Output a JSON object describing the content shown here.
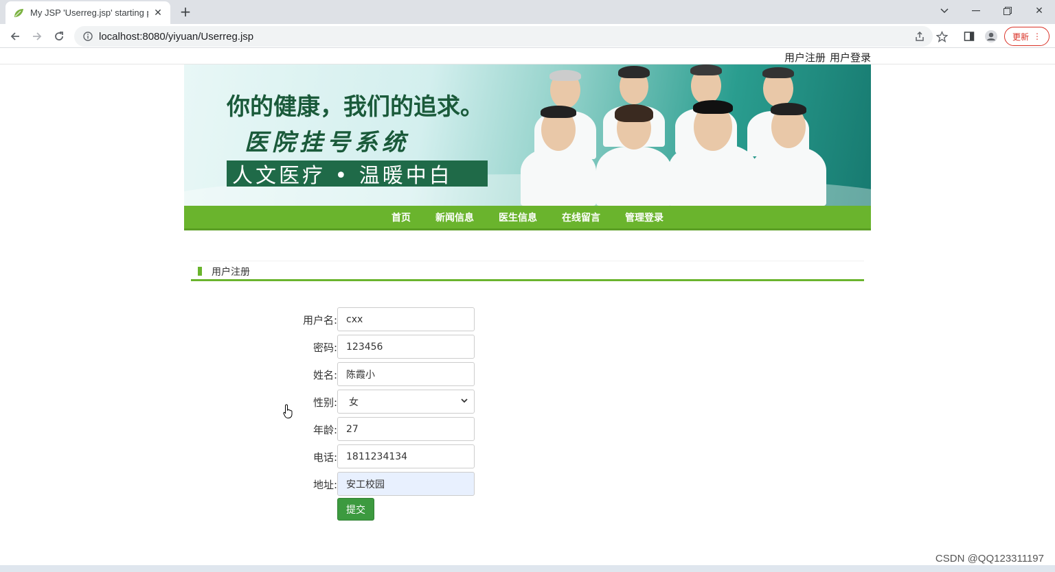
{
  "browser": {
    "tab_title": "My JSP 'Userreg.jsp' starting p",
    "url": "localhost:8080/yiyuan/Userreg.jsp",
    "update_label": "更新"
  },
  "top_links": {
    "register": "用户注册",
    "login": "用户登录"
  },
  "banner": {
    "slogan_line1": "你的健康，我们的追求。",
    "slogan_line2": "医院挂号系统",
    "ribbon": "人文医疗 • 温暖中白"
  },
  "nav": {
    "items": [
      "首页",
      "新闻信息",
      "医生信息",
      "在线留言",
      "管理登录"
    ]
  },
  "section": {
    "title": "用户注册"
  },
  "form": {
    "username": {
      "label": "用户名:",
      "value": "cxx"
    },
    "password": {
      "label": "密码:",
      "value": "123456"
    },
    "name": {
      "label": "姓名:",
      "value": "陈霞小"
    },
    "gender": {
      "label": "性别:",
      "value": "女"
    },
    "age": {
      "label": "年龄:",
      "value": "27"
    },
    "phone": {
      "label": "电话:",
      "value": "1811234134"
    },
    "address": {
      "label": "地址:",
      "value": "安工校园"
    },
    "submit_label": "提交"
  },
  "watermark": "CSDN @QQ123311197",
  "colors": {
    "nav_green": "#6ab42d",
    "submit_green": "#3c9a3f",
    "banner_teal": "#2a9d8f"
  },
  "icons": [
    "leaf-favicon",
    "close-icon",
    "plus-icon",
    "back-icon",
    "forward-icon",
    "reload-icon",
    "info-icon",
    "share-icon",
    "star-icon",
    "sidepanel-icon",
    "profile-icon",
    "menu-icon",
    "chevron-down-icon",
    "hand-cursor-icon"
  ]
}
